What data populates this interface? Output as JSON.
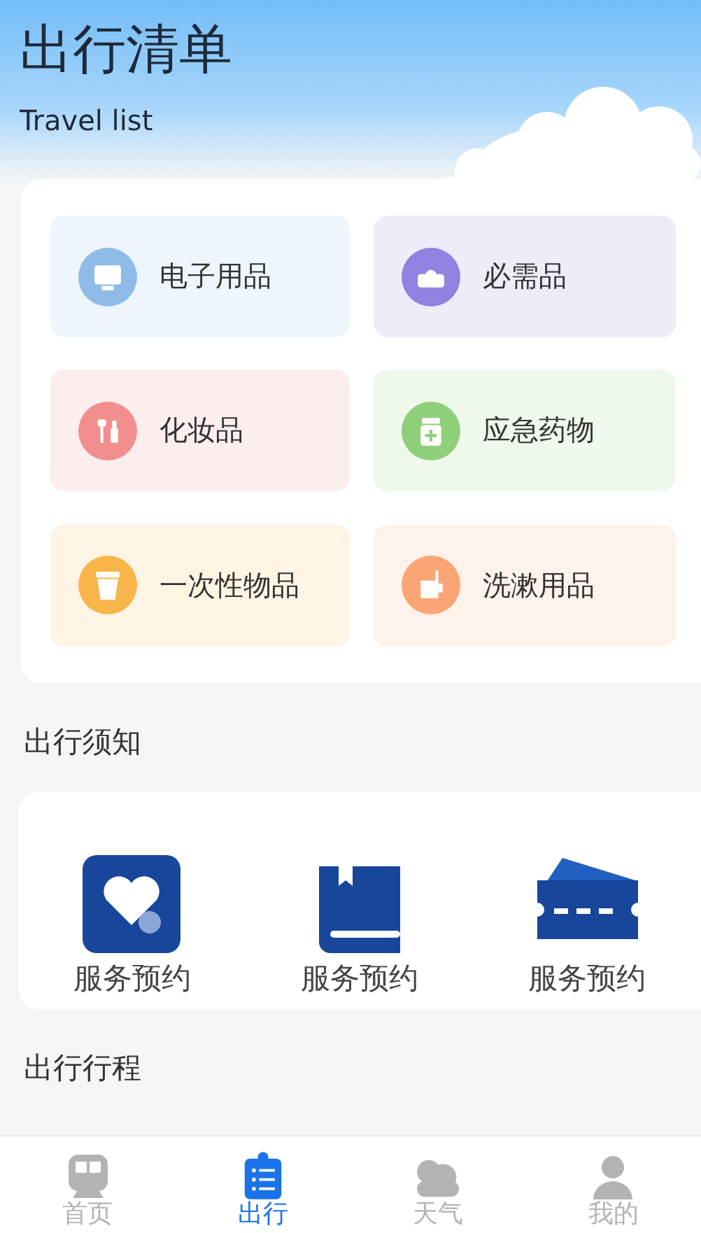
{
  "header": {
    "title": "出行清单",
    "subtitle": "Travel list"
  },
  "categories": [
    {
      "label": "电子用品",
      "color": "#8fbbe8"
    },
    {
      "label": "必需品",
      "color": "#9281e0"
    },
    {
      "label": "化妆品",
      "color": "#f38e8e"
    },
    {
      "label": "应急药物",
      "color": "#8fcf7a"
    },
    {
      "label": "一次性物品",
      "color": "#f8b54a"
    },
    {
      "label": "洗漱用品",
      "color": "#fba574"
    }
  ],
  "notice": {
    "title": "出行须知",
    "services": [
      {
        "label": "服务预约"
      },
      {
        "label": "服务预约"
      },
      {
        "label": "服务预约"
      }
    ]
  },
  "itinerary": {
    "title": "出行行程"
  },
  "tab_bar": [
    {
      "label": "首页",
      "selected": false
    },
    {
      "label": "出行",
      "selected": true
    },
    {
      "label": "天气",
      "selected": false
    },
    {
      "label": "我的",
      "selected": false
    }
  ]
}
